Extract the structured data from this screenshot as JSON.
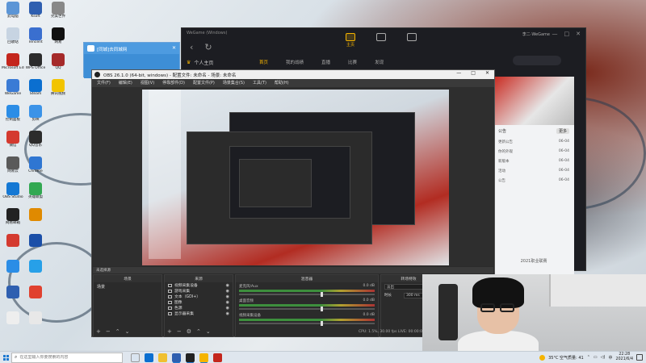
{
  "desktop": {
    "icons": [
      "此电脑",
      "Ksoft",
      "完美世界",
      "回收站",
      "Tencent",
      "网易",
      "Microsoft Edge",
      "WPS Office",
      "QQ",
      "WeGame",
      "Steam",
      "腾讯视频",
      "控制面板",
      "剪映",
      "微信",
      "QQ音乐",
      "网易云",
      "Chrome",
      "OBS Studio",
      "英雄联盟",
      "网易邮箱"
    ]
  },
  "tongcheng_window": {
    "title": "[同城]去同城网"
  },
  "wegame": {
    "title": "WeGame (Windows)",
    "tabs": [
      "主页",
      "",
      ""
    ],
    "username": "李二·WeGame",
    "sub_title": "个人主页",
    "game_tabs": [
      "首页",
      "我的战绩",
      "直播",
      "比赛",
      "发现"
    ],
    "notice_header": "公告",
    "more_label": "更多",
    "notices": [
      {
        "title": "更新公告",
        "date": "06-04"
      },
      {
        "title": "你的外观",
        "date": "06-04"
      },
      {
        "title": "新版本",
        "date": "06-04"
      },
      {
        "title": "活动",
        "date": "06-04"
      },
      {
        "title": "公告",
        "date": "06-04"
      }
    ],
    "footer": "2021职业联赛"
  },
  "obs": {
    "title": "OBS 26.1.0 (64-bit, windows) - 配置文件: 未命名 - 场景: 未命名",
    "window_controls": [
      "—",
      "□",
      "✕"
    ],
    "menu": [
      "文件(F)",
      "编辑(E)",
      "视图(V)",
      "停靠部件(D)",
      "配置文件(P)",
      "场景集合(S)",
      "工具(T)",
      "帮助(H)"
    ],
    "scene_bar_label": "未选择源",
    "docks": {
      "scenes": {
        "title": "场景",
        "items": [
          "场景"
        ]
      },
      "sources": {
        "title": "来源",
        "items": [
          "视频采集设备",
          "游戏采集",
          "文本（GDI+）",
          "图像",
          "色源",
          "显示器采集"
        ]
      },
      "mixer": {
        "title": "混音器",
        "rows": [
          {
            "name": "麦克风/Aux",
            "db": "0.0 dB"
          },
          {
            "name": "桌面音频",
            "db": "0.0 dB"
          },
          {
            "name": "视频采集设备",
            "db": "0.0 dB"
          }
        ]
      },
      "transitions": {
        "title": "转场特效",
        "type": "淡出",
        "duration_label": "时长",
        "duration_value": "300 ms"
      }
    },
    "status": "CPU: 1.5%, 30.00 fps   LIVE: 00:00:00   REC: 00:00:00"
  },
  "taskbar": {
    "search_placeholder": "在这里输入你要搜索的内容",
    "weather": "35°C  空气质量: 41",
    "time": "22:28",
    "date": "2021/6/4"
  },
  "colors": {
    "wegame_accent": "#f5b400",
    "windows_accent": "#1f7ad1",
    "obs_bg": "#2b2b2b"
  }
}
